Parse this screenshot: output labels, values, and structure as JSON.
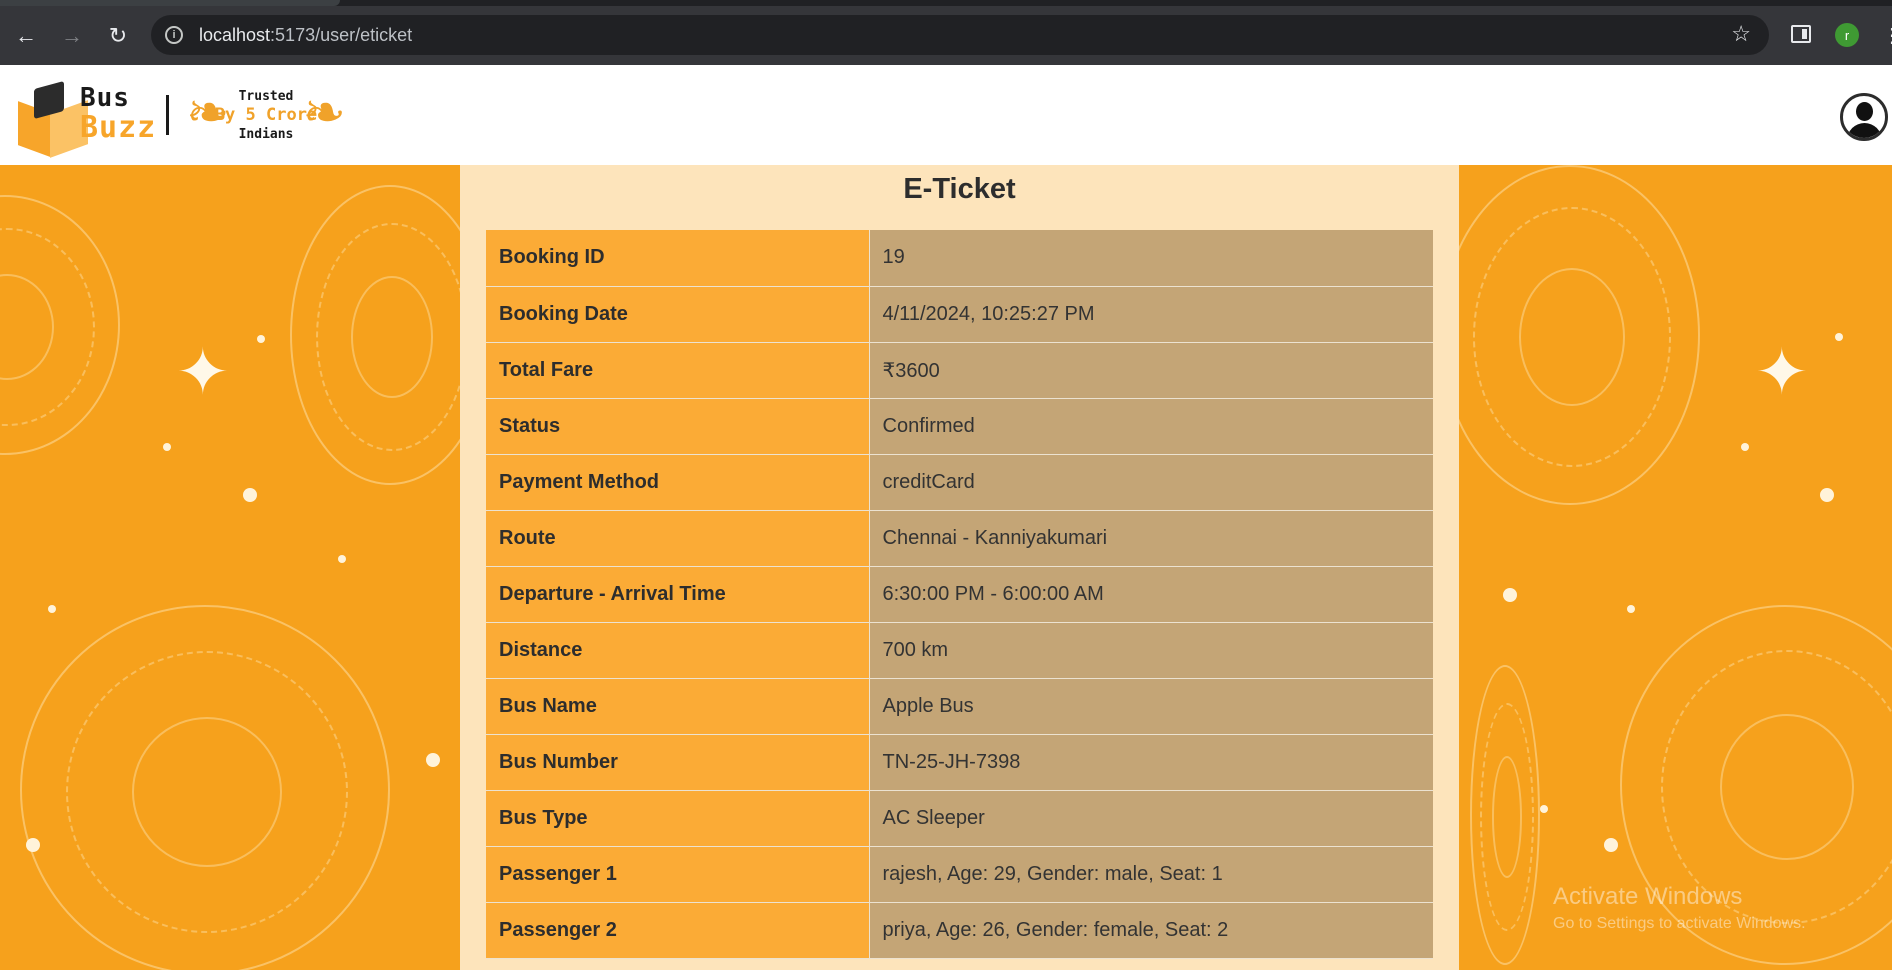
{
  "browser": {
    "url_host": "localhost",
    "url_path": ":5173/user/eticket",
    "profile_initial": "r"
  },
  "header": {
    "logo_line1": "Bus",
    "logo_line2": "Buzz",
    "badge_line1": "Trusted",
    "badge_line2": "By 5 Crore",
    "badge_line3": "Indians"
  },
  "ticket": {
    "title": "E-Ticket",
    "rows": [
      {
        "label": "Booking ID",
        "value": "19"
      },
      {
        "label": "Booking Date",
        "value": "4/11/2024, 10:25:27 PM"
      },
      {
        "label": "Total Fare",
        "value": "₹3600"
      },
      {
        "label": "Status",
        "value": "Confirmed"
      },
      {
        "label": "Payment Method",
        "value": "creditCard"
      },
      {
        "label": "Route",
        "value": "Chennai - Kanniyakumari"
      },
      {
        "label": "Departure - Arrival Time",
        "value": "6:30:00 PM - 6:00:00 AM"
      },
      {
        "label": "Distance",
        "value": "700 km"
      },
      {
        "label": "Bus Name",
        "value": "Apple Bus"
      },
      {
        "label": "Bus Number",
        "value": "TN-25-JH-7398"
      },
      {
        "label": "Bus Type",
        "value": "AC Sleeper"
      },
      {
        "label": "Passenger 1",
        "value": "rajesh, Age: 29, Gender: male, Seat: 1"
      },
      {
        "label": "Passenger 2",
        "value": "priya, Age: 26, Gender: female, Seat: 2"
      }
    ]
  },
  "watermark": {
    "line1": "Activate Windows",
    "line2": "Go to Settings to activate Windows."
  },
  "colors": {
    "page_bg": "#f6a11c",
    "panel_bg": "#fde4bb",
    "label_cell": "#fbab36",
    "value_cell": "#c4a576"
  }
}
